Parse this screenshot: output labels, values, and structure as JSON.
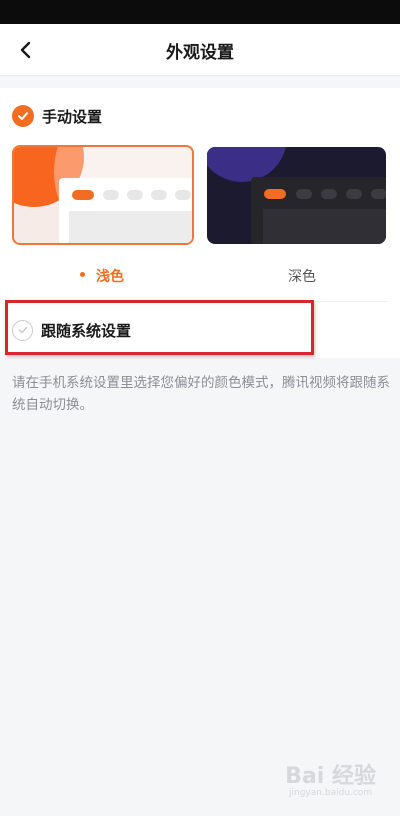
{
  "nav": {
    "title": "外观设置",
    "back_icon": "chevron-left-icon"
  },
  "manual": {
    "label": "手动设置",
    "checked": true,
    "themes": [
      {
        "key": "light",
        "label": "浅色",
        "selected": true
      },
      {
        "key": "dark",
        "label": "深色",
        "selected": false
      }
    ]
  },
  "follow_system": {
    "label": "跟随系统设置",
    "checked": false
  },
  "description": "请在手机系统设置里选择您偏好的颜色模式，腾讯视频将跟随系统自动切换。",
  "colors": {
    "accent": "#f26c21",
    "highlight_frame": "#d8262c",
    "dark_preview": "#1b1a2e"
  },
  "watermark": {
    "main": "Bai 经验",
    "sub": "jingyan.baidu.com"
  }
}
